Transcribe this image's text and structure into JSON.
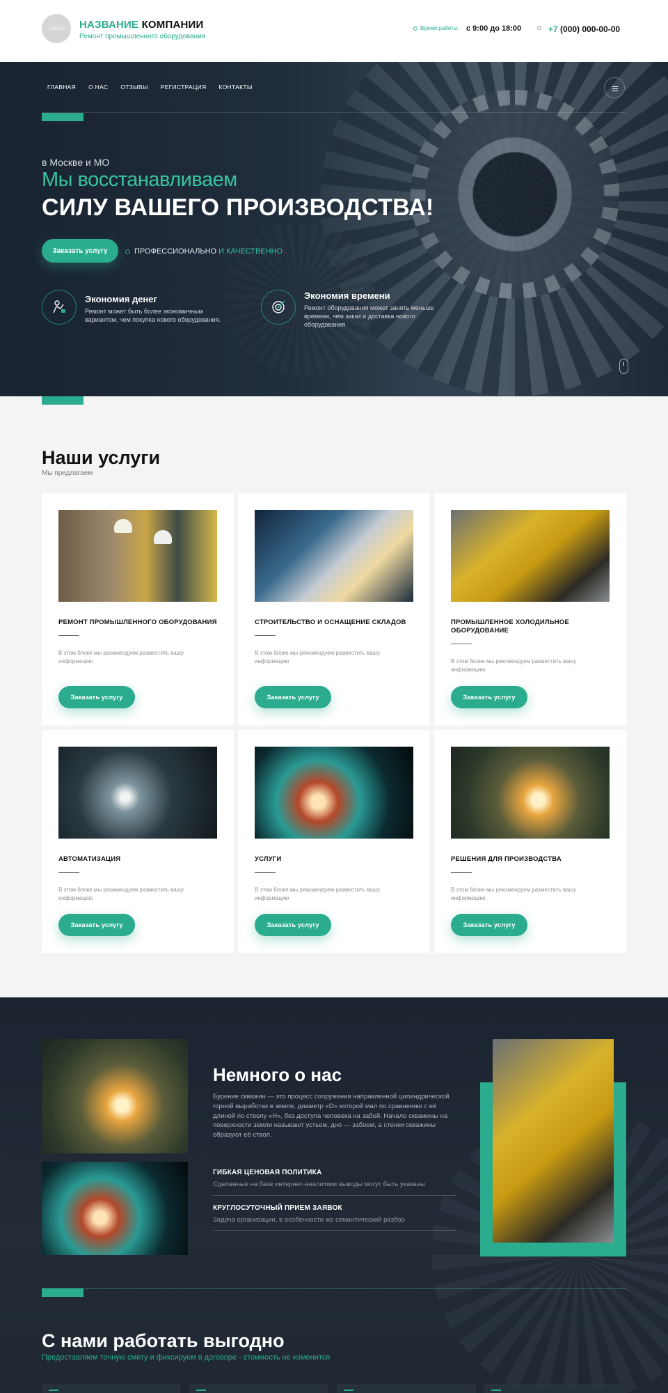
{
  "header": {
    "logo_text": "LOGO",
    "company_name_accent": "НАЗВАНИЕ",
    "company_name_rest": " КОМПАНИИ",
    "tagline": "Ремонт промышленного оборудования",
    "hours_label": "Время работы:",
    "hours_value": "с 9:00 до 18:00",
    "phone_prefix": "+7",
    "phone_rest": " (000) 000-00-00"
  },
  "nav": {
    "items": [
      "ГЛАВНАЯ",
      "О НАС",
      "ОТЗЫВЫ",
      "РЕГИСТРАЦИЯ",
      "КОНТАКТЫ"
    ]
  },
  "hero": {
    "city": "в Москве и МО",
    "line1": "Мы восстанавливаем",
    "line2": "СИЛУ ВАШЕГО ПРОИЗВОДСТВА!",
    "cta": "Заказать услугу",
    "pro_plain": "ПРОФЕССИОНАЛЬНО",
    "pro_accent": " И КАЧЕСТВЕННО",
    "features": [
      {
        "title": "Экономия денег",
        "text": "Ремонт может быть более экономичным вариантом, чем покупка нового оборудования.",
        "icon": "money-saving-icon"
      },
      {
        "title": "Экономия времени",
        "text": "Ремонт оборудования может занять меньше времени, чем заказ и доставка нового оборудования",
        "icon": "target-icon"
      }
    ]
  },
  "services": {
    "title": "Наши услуги",
    "subtitle": "Мы предлагаем",
    "button_label": "Заказать услугу",
    "description": "В этом блоке мы рекомендуем разместить вашу информацию",
    "cards": [
      {
        "title": "РЕМОНТ ПРОМЫШЛЕННОГО ОБОРУДОВАНИЯ"
      },
      {
        "title": "СТРОИТЕЛЬСТВО И ОСНАЩЕНИЕ СКЛАДОВ"
      },
      {
        "title": "ПРОМЫШЛЕННОЕ ХОЛОДИЛЬНОЕ ОБОРУДОВАНИЕ"
      },
      {
        "title": "АВТОМАТИЗАЦИЯ"
      },
      {
        "title": "УСЛУГИ"
      },
      {
        "title": "РЕШЕНИЯ ДЛЯ ПРОИЗВОДСТВА"
      }
    ]
  },
  "about": {
    "title": "Немного о нас",
    "text": "Бурение скважин — это процесс сооружения направленной цилиндрической горной выработки в земле, диаметр «D» которой мал по сравнению с её длиной по стволу «H», без доступа человека на забой. Начало скважины на поверхности земли называют устьем, дно — забоем, а стенки скважины образуют её ствол.",
    "items": [
      {
        "title": "ГИБКАЯ ЦЕНОВАЯ ПОЛИТИКА",
        "text": "Сделанные на базе интернет-аналитики выводы могут быть указаны"
      },
      {
        "title": "КРУГЛОСУТОЧНЫЙ ПРИЕМ ЗАЯВОК",
        "text": "Задача организации, в особенности же семантический разбор"
      }
    ]
  },
  "advantages": {
    "title": "С нами работать выгодно",
    "subtitle": "Предоставляем точную смету и фиксируем в договоре - стоимость не изменится"
  },
  "colors": {
    "accent": "#2bac8e",
    "dark": "#1f2832",
    "light_bg": "#f4f4f4"
  }
}
